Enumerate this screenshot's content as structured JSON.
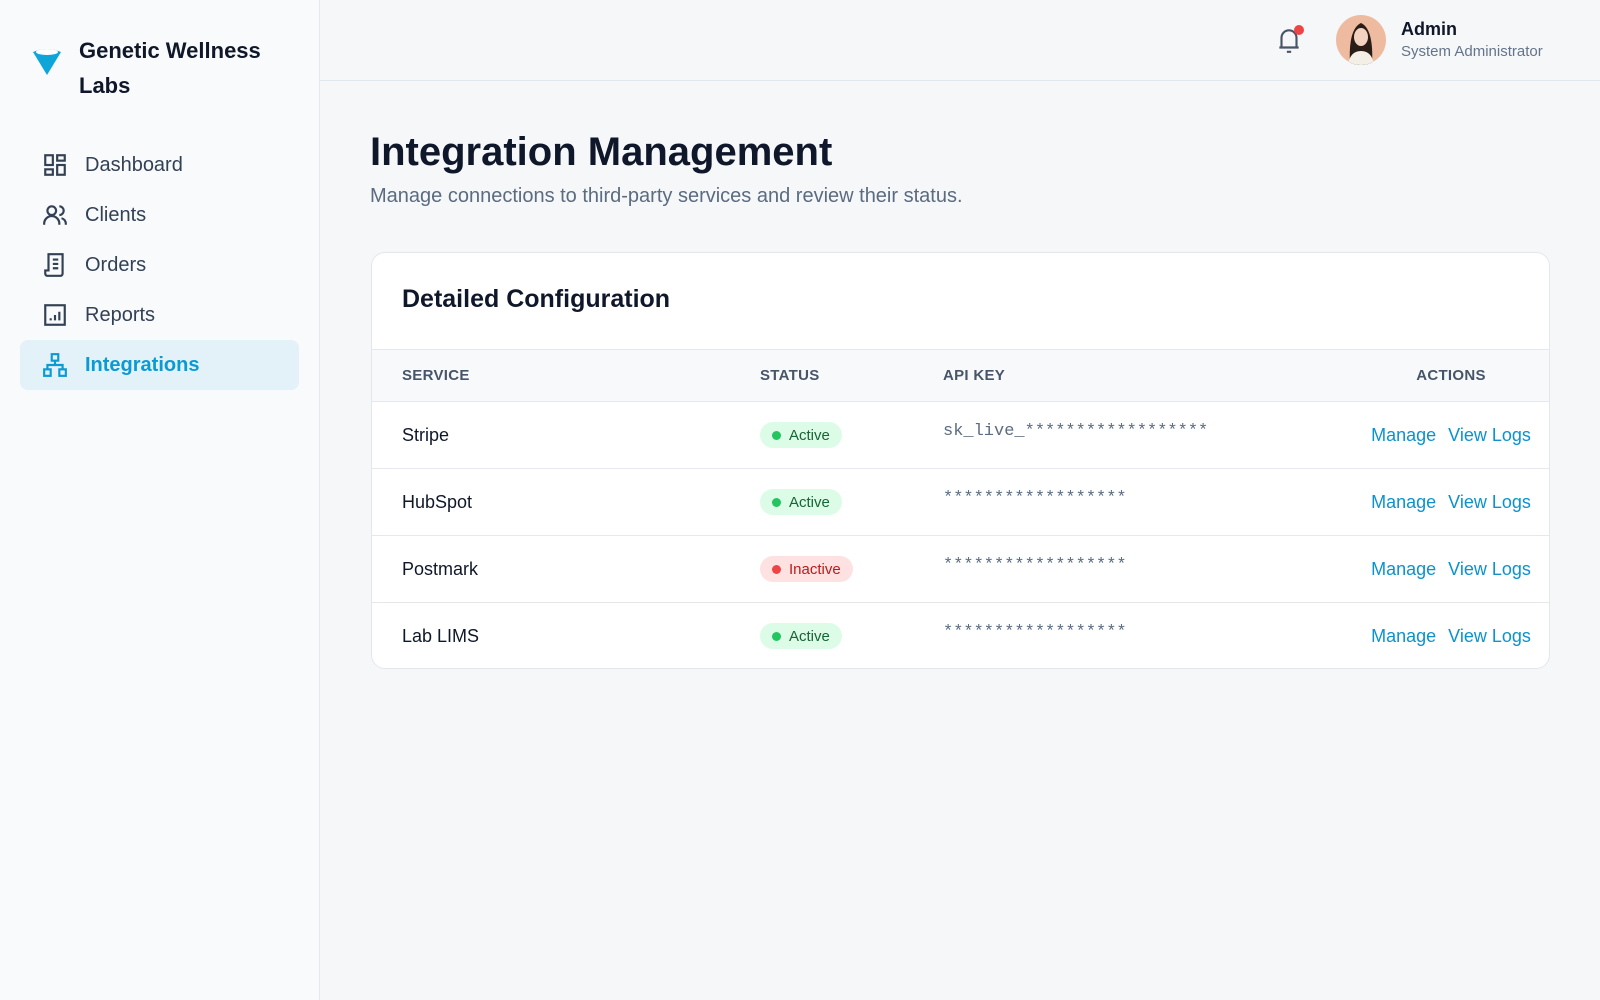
{
  "brand": {
    "name": "Genetic Wellness Labs",
    "color": "#0ea5d9"
  },
  "sidebar": {
    "items": [
      {
        "label": "Dashboard",
        "icon": "dashboard-icon"
      },
      {
        "label": "Clients",
        "icon": "users-icon"
      },
      {
        "label": "Orders",
        "icon": "receipt-icon"
      },
      {
        "label": "Reports",
        "icon": "chart-icon"
      },
      {
        "label": "Integrations",
        "icon": "sitemap-icon",
        "active": true
      }
    ]
  },
  "user": {
    "name": "Admin",
    "role": "System Administrator"
  },
  "page": {
    "title": "Integration Management",
    "subtitle": "Manage connections to third-party services and review their status."
  },
  "card": {
    "title": "Detailed Configuration",
    "columns": [
      "SERVICE",
      "STATUS",
      "API KEY",
      "ACTIONS"
    ],
    "rows": [
      {
        "service": "Stripe",
        "status": "Active",
        "api_key": "sk_live_******************",
        "actions": [
          "Manage",
          "View Logs"
        ]
      },
      {
        "service": "HubSpot",
        "status": "Active",
        "api_key": "******************",
        "actions": [
          "Manage",
          "View Logs"
        ]
      },
      {
        "service": "Postmark",
        "status": "Inactive",
        "api_key": "******************",
        "actions": [
          "Manage",
          "View Logs"
        ]
      },
      {
        "service": "Lab LIMS",
        "status": "Active",
        "api_key": "******************",
        "actions": [
          "Manage",
          "View Logs"
        ]
      }
    ]
  }
}
